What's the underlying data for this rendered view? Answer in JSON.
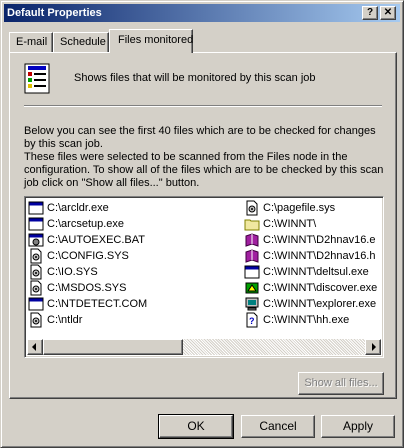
{
  "window": {
    "title": "Default Properties"
  },
  "titlebar": {
    "help_label": "?",
    "close_label": "✕"
  },
  "tabs": [
    {
      "label": "E-mail",
      "active": false
    },
    {
      "label": "Schedule",
      "active": false
    },
    {
      "label": "Files monitored",
      "active": true
    }
  ],
  "header": {
    "text": "Shows files that will be monitored by this scan job"
  },
  "description": {
    "line1": "Below you can see the first 40 files which are to be checked for changes by this scan job.",
    "line2": "These files were selected to be scanned from the Files node in the configuration. To show all of the files which are to be checked by this scan job click on \"Show all files...\" button."
  },
  "files_left": [
    {
      "name": "C:\\arcldr.exe",
      "icon": "app-window-icon"
    },
    {
      "name": "C:\\arcsetup.exe",
      "icon": "app-window-icon"
    },
    {
      "name": "C:\\AUTOEXEC.BAT",
      "icon": "batch-file-icon"
    },
    {
      "name": "C:\\CONFIG.SYS",
      "icon": "system-file-icon"
    },
    {
      "name": "C:\\IO.SYS",
      "icon": "system-file-icon"
    },
    {
      "name": "C:\\MSDOS.SYS",
      "icon": "system-file-icon"
    },
    {
      "name": "C:\\NTDETECT.COM",
      "icon": "app-window-icon"
    },
    {
      "name": "C:\\ntldr",
      "icon": "system-file-icon"
    }
  ],
  "files_right": [
    {
      "name": "C:\\pagefile.sys",
      "icon": "system-file-icon"
    },
    {
      "name": "C:\\WINNT\\",
      "icon": "folder-icon"
    },
    {
      "name": "C:\\WINNT\\D2hnav16.e",
      "icon": "book-icon"
    },
    {
      "name": "C:\\WINNT\\D2hnav16.h",
      "icon": "book-icon"
    },
    {
      "name": "C:\\WINNT\\deltsul.exe",
      "icon": "app-window-icon"
    },
    {
      "name": "C:\\WINNT\\discover.exe",
      "icon": "discover-icon"
    },
    {
      "name": "C:\\WINNT\\explorer.exe",
      "icon": "computer-icon"
    },
    {
      "name": "C:\\WINNT\\hh.exe",
      "icon": "help-file-icon"
    }
  ],
  "buttons": {
    "show_all": "Show all files...",
    "ok": "OK",
    "cancel": "Cancel",
    "apply": "Apply"
  },
  "colors": {
    "title_bar_start": "#0a246a",
    "title_bar_end": "#a6caf0",
    "face": "#d4d0c8"
  }
}
